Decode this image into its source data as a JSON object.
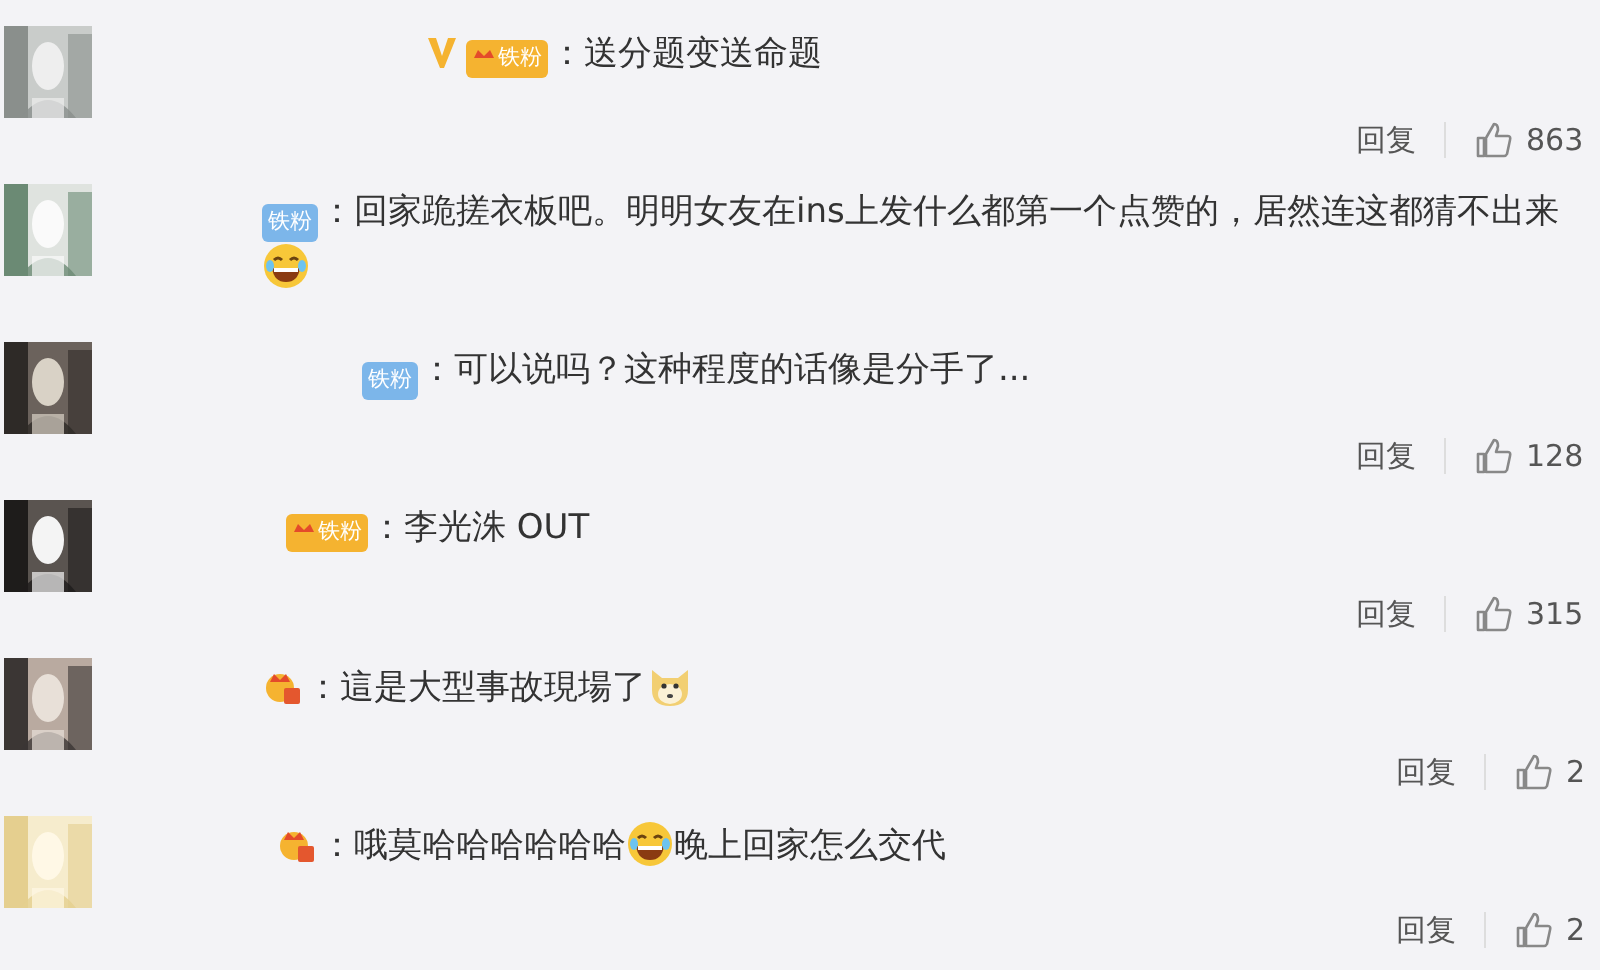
{
  "comments": [
    {
      "verified": true,
      "badge": {
        "kind": "gold",
        "label": "铁粉"
      },
      "content": [
        {
          "kind": "text",
          "text": "：送分题变送命题"
        }
      ],
      "actions": {
        "reply": "回复",
        "likes": "863"
      }
    },
    {
      "verified": false,
      "badge": {
        "kind": "blue",
        "label": "铁粉"
      },
      "content": [
        {
          "kind": "text",
          "text": "：回家跪搓衣板吧。明明女友在ins上发什么都第一个点赞的，居然连这都猜不出来"
        },
        {
          "kind": "laugh"
        }
      ]
    },
    {
      "verified": false,
      "badge": {
        "kind": "blue",
        "label": "铁粉"
      },
      "content": [
        {
          "kind": "text",
          "text": "：可以说吗？这种程度的话像是分手了..."
        }
      ],
      "actions": {
        "reply": "回复",
        "likes": "128"
      }
    },
    {
      "verified": false,
      "badge": {
        "kind": "gold",
        "label": "铁粉"
      },
      "content": [
        {
          "kind": "text",
          "text": "：李光洙 OUT"
        }
      ],
      "actions": {
        "reply": "回复",
        "likes": "315"
      }
    },
    {
      "verified": false,
      "badge": {
        "kind": "crown"
      },
      "content": [
        {
          "kind": "text",
          "text": "：這是大型事故現場了"
        },
        {
          "kind": "doge"
        }
      ],
      "actions": {
        "reply": "回复",
        "likes": "2"
      }
    },
    {
      "verified": false,
      "badge": {
        "kind": "crown"
      },
      "content": [
        {
          "kind": "text",
          "text": "：哦莫哈哈哈哈哈哈"
        },
        {
          "kind": "laugh"
        },
        {
          "kind": "text",
          "text": "晚上回家怎么交代"
        }
      ],
      "actions": {
        "reply": "回复",
        "likes": "2"
      }
    }
  ]
}
